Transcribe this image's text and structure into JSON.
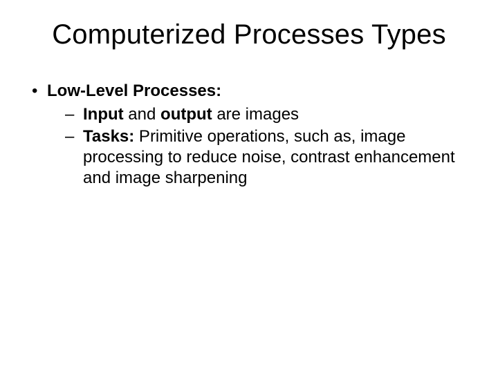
{
  "title": "Computerized Processes Types",
  "bullets": [
    {
      "heading": "Low-Level Processes:",
      "sub": [
        {
          "bold1": "Input",
          "text1": " and ",
          "bold2": "output",
          "text2": " are images"
        },
        {
          "bold1": "Tasks:",
          "text1": " Primitive operations, such as, image processing to reduce noise, contrast enhancement and image sharpening"
        }
      ]
    }
  ]
}
